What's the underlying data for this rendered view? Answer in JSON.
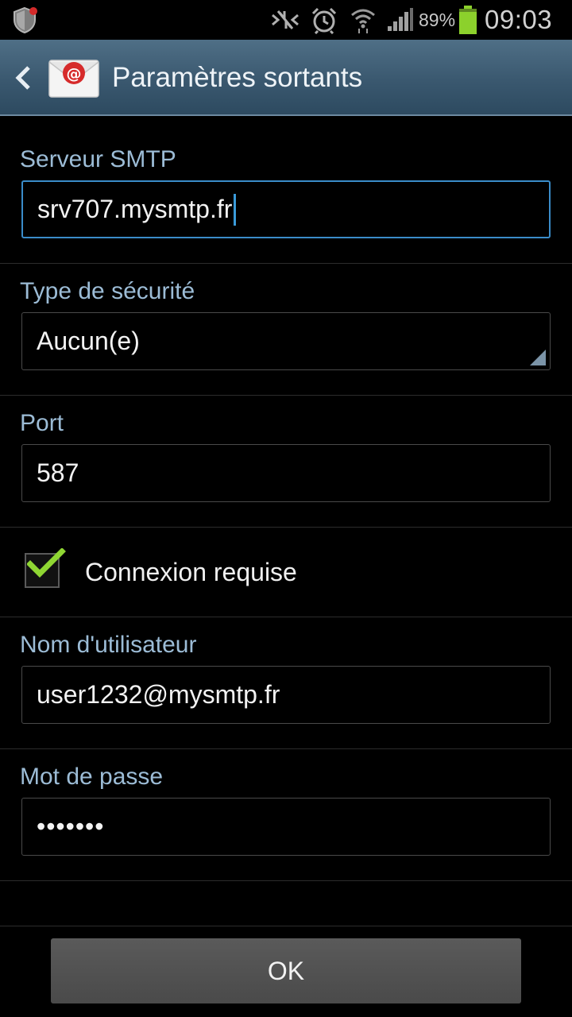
{
  "status_bar": {
    "battery_percent": "89%",
    "time": "09:03",
    "icons": [
      "shield-notification-icon",
      "nfc-mute-icon",
      "alarm-icon",
      "wifi-icon",
      "signal-icon",
      "battery-icon"
    ]
  },
  "action_bar": {
    "title": "Paramètres sortants",
    "app_icon": "email-app-icon",
    "back_icon": "chevron-left-icon"
  },
  "form": {
    "smtp_server": {
      "label": "Serveur SMTP",
      "value": "srv707.mysmtp.fr"
    },
    "security_type": {
      "label": "Type de sécurité",
      "value": "Aucun(e)"
    },
    "port": {
      "label": "Port",
      "value": "587"
    },
    "login_required": {
      "label": "Connexion requise",
      "checked": true
    },
    "username": {
      "label": "Nom d'utilisateur",
      "value": "user1232@mysmtp.fr"
    },
    "password": {
      "label": "Mot de passe",
      "value": "•••••••"
    }
  },
  "buttons": {
    "ok": "OK"
  },
  "colors": {
    "accent": "#3a8cc9",
    "label": "#9cbcd6",
    "check": "#8fd633",
    "battery": "#8cd12c",
    "action_bar": "#3a586f"
  }
}
